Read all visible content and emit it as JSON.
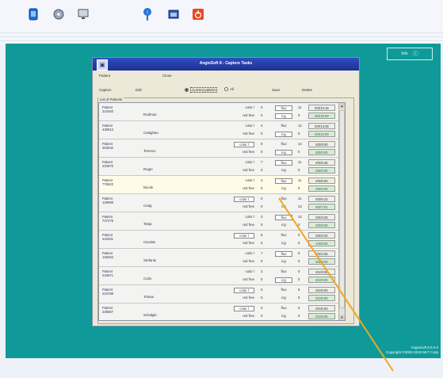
{
  "toolbar": {
    "icons": [
      "app-icon",
      "disc-icon",
      "monitor-icon",
      "info-icon",
      "window-icon",
      "power-icon"
    ],
    "accent_color": "#e84a1e"
  },
  "about_button": {
    "label": "Info",
    "icon": "i"
  },
  "version": {
    "line1": "AngioSoft 8.0.0.0",
    "line2": "Copyright ©2002-2010 MLT Corp"
  },
  "dialog": {
    "title": "AngioSoft 8 - Capture Tasks",
    "patient_label": "Patient",
    "close_label": "Close",
    "caption_label": "Caption",
    "edit_label": "Edit",
    "radio_current": "Current patient",
    "radio_all": "All",
    "save_label": "Save",
    "delete_label": "Delete",
    "group_label": "List of Patients"
  },
  "patients": [
    {
      "label": "Patient",
      "id": "323493",
      "name": "Rodman",
      "c1": "color l",
      "n1": "0",
      "c2": "red free",
      "n2": "0",
      "m1": "fluo",
      "k1": "11",
      "m2": "icg",
      "k2": "0",
      "d1": "8/3/10:16",
      "d2": "8/3/10:00",
      "c1box": false,
      "m1box": true,
      "m2box": true
    },
    {
      "label": "Patient",
      "id": "438912",
      "name": "Calaghan",
      "c1": "color l",
      "n1": "4",
      "c2": "red free",
      "n2": "0",
      "m1": "fluo",
      "k1": "12",
      "m2": "icg",
      "k2": "0",
      "d1": "8/3/13:25",
      "d2": "8/3/12:00",
      "c1box": false,
      "m1box": false,
      "m2box": true
    },
    {
      "label": "Patient",
      "id": "453032",
      "name": "Terence",
      "c1": "color l",
      "n1": "9",
      "c2": "red free",
      "n2": "0",
      "m1": "fluo",
      "k1": "14",
      "m2": "icg",
      "k2": "0",
      "d1": "8/3/9:00",
      "d2": "8/3/9:00",
      "c1box": true,
      "m1box": false,
      "m2box": true
    },
    {
      "label": "Patient",
      "id": "234570",
      "name": "Roger",
      "c1": "color l",
      "n1": "7",
      "c2": "red free",
      "n2": "0",
      "m1": "fluo",
      "k1": "11",
      "m2": "icg",
      "k2": "0",
      "d1": "8/3/8:45",
      "d2": "8/3/9:00",
      "c1box": false,
      "m1box": true,
      "m2box": false
    },
    {
      "label": "Patient",
      "id": "776622",
      "name": "Nicole",
      "c1": "color l",
      "n1": "4",
      "c2": "red free",
      "n2": "0",
      "m1": "fluo",
      "k1": "11",
      "m2": "icg",
      "k2": "0",
      "d1": "8/3/8:00",
      "d2": "8/3/9:00",
      "c1box": false,
      "m1box": true,
      "m2box": false
    },
    {
      "label": "Patient",
      "id": "129999",
      "name": "Craig",
      "c1": "color l",
      "n1": "0",
      "c2": "red free",
      "n2": "0",
      "m1": "fluo",
      "k1": "11",
      "m2": "icg",
      "k2": "13",
      "d1": "8/3/6:23",
      "d2": "8/3/7:01",
      "c1box": true,
      "m1box": false,
      "m2box": false
    },
    {
      "label": "Patient",
      "id": "727275",
      "name": "Tanja",
      "c1": "color l",
      "n1": "3",
      "c2": "red free",
      "n2": "0",
      "m1": "fluo",
      "k1": "12",
      "m2": "icg",
      "k2": "0",
      "d1": "8/3/4:26",
      "d2": "8/3/8:00",
      "c1box": false,
      "m1box": true,
      "m2box": false
    },
    {
      "label": "Patient",
      "id": "443331",
      "name": "Carolas",
      "c1": "color l",
      "n1": "6",
      "c2": "red free",
      "n2": "0",
      "m1": "fluo",
      "k1": "0",
      "m2": "icg",
      "k2": "0",
      "d1": "8/3/3:32",
      "d2": "4/3/8:00",
      "c1box": true,
      "m1box": false,
      "m2box": false
    },
    {
      "label": "Patient",
      "id": "125284",
      "name": "Stefanie",
      "c1": "color l",
      "n1": "7",
      "c2": "red free",
      "n2": "0",
      "m1": "fluo",
      "k1": "0",
      "m2": "icg",
      "k2": "0",
      "d1": "8/3/2:05",
      "d2": "8/3/8:00",
      "c1box": false,
      "m1box": true,
      "m2box": false
    },
    {
      "label": "Patient",
      "id": "234871",
      "name": "Colin",
      "c1": "color l",
      "n1": "3",
      "c2": "red free",
      "n2": "0",
      "m1": "fluo",
      "k1": "0",
      "m2": "icg",
      "k2": "0",
      "d1": "8/1/9:00",
      "d2": "8/1/9:00",
      "c1box": false,
      "m1box": false,
      "m2box": true
    },
    {
      "label": "Patient",
      "id": "234789",
      "name": "Tomas",
      "c1": "color l",
      "n1": "0",
      "c2": "red free",
      "n2": "0",
      "m1": "fluo",
      "k1": "0",
      "m2": "icg",
      "k2": "0",
      "d1": "8/1/8:00",
      "d2": "8/1/8:00",
      "c1box": true,
      "m1box": false,
      "m2box": false
    },
    {
      "label": "Patient",
      "id": "235567",
      "name": "Schalgin",
      "c1": "color l",
      "n1": "0",
      "c2": "red free",
      "n2": "0",
      "m1": "fluo",
      "k1": "0",
      "m2": "icg",
      "k2": "0",
      "d1": "8/1/8:00",
      "d2": "8/1/8:00",
      "c1box": true,
      "m1box": false,
      "m2box": false
    }
  ]
}
